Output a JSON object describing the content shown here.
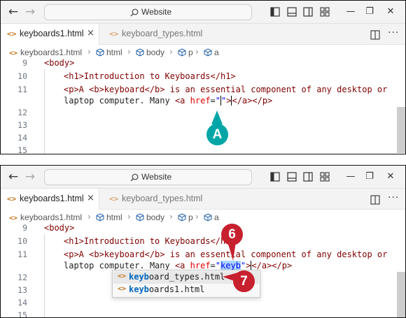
{
  "colors": {
    "accent_teal": "#00a6a6",
    "accent_red": "#c7202e",
    "tag": "#800000",
    "attr": "#e50000",
    "string": "#0000ff",
    "selection": "#add6ff"
  },
  "top": {
    "search_label": "Website",
    "tabs": [
      {
        "icon": "<>",
        "label": "keyboards1.html",
        "close": "×"
      },
      {
        "icon": "<>",
        "label": "keyboard_types.html"
      }
    ],
    "breadcrumb": [
      {
        "icon": "html-file-icon",
        "label": "keyboards1.html"
      },
      {
        "icon": "cube-icon",
        "label": "html"
      },
      {
        "icon": "cube-icon",
        "label": "body"
      },
      {
        "icon": "cube-icon",
        "label": "p"
      },
      {
        "icon": "cube-icon",
        "label": "a"
      }
    ],
    "lines": [
      {
        "n": "9"
      },
      {
        "n": "10"
      },
      {
        "n": "11"
      },
      {
        "n": ""
      },
      {
        "n": "12"
      },
      {
        "n": "13"
      },
      {
        "n": "14"
      },
      {
        "n": "15"
      }
    ],
    "code": {
      "body": "<body>",
      "h1": "<h1>Introduction to Keyboards</h1>",
      "p_open": "<p>A <b>keyboard</b> is an essential component of any desktop or",
      "lt": "laptop computer. Many ",
      "a_open": "<a",
      "href": "href",
      "eq": "=",
      "q": "\"",
      "after": ">",
      "close": "</a></p>"
    },
    "callout": "A"
  },
  "bottom": {
    "search_label": "Website",
    "tabs": [
      {
        "icon": "<>",
        "label": "keyboards1.html",
        "close": "×"
      },
      {
        "icon": "<>",
        "label": "keyboard_types.html"
      }
    ],
    "breadcrumb": [
      {
        "icon": "html-file-icon",
        "label": "keyboards1.html"
      },
      {
        "icon": "cube-icon",
        "label": "html"
      },
      {
        "icon": "cube-icon",
        "label": "body"
      },
      {
        "icon": "cube-icon",
        "label": "p"
      },
      {
        "icon": "cube-icon",
        "label": "a"
      }
    ],
    "lines": [
      {
        "n": "9"
      },
      {
        "n": "10"
      },
      {
        "n": "11"
      },
      {
        "n": ""
      },
      {
        "n": "12"
      },
      {
        "n": "13"
      },
      {
        "n": "14"
      },
      {
        "n": "15"
      }
    ],
    "typed": "keyb",
    "suggestions": [
      {
        "match": "keyb",
        "rest": "oard_types.html"
      },
      {
        "match": "keyb",
        "rest": "oards1.html"
      }
    ],
    "callouts": [
      "6",
      "7"
    ]
  }
}
